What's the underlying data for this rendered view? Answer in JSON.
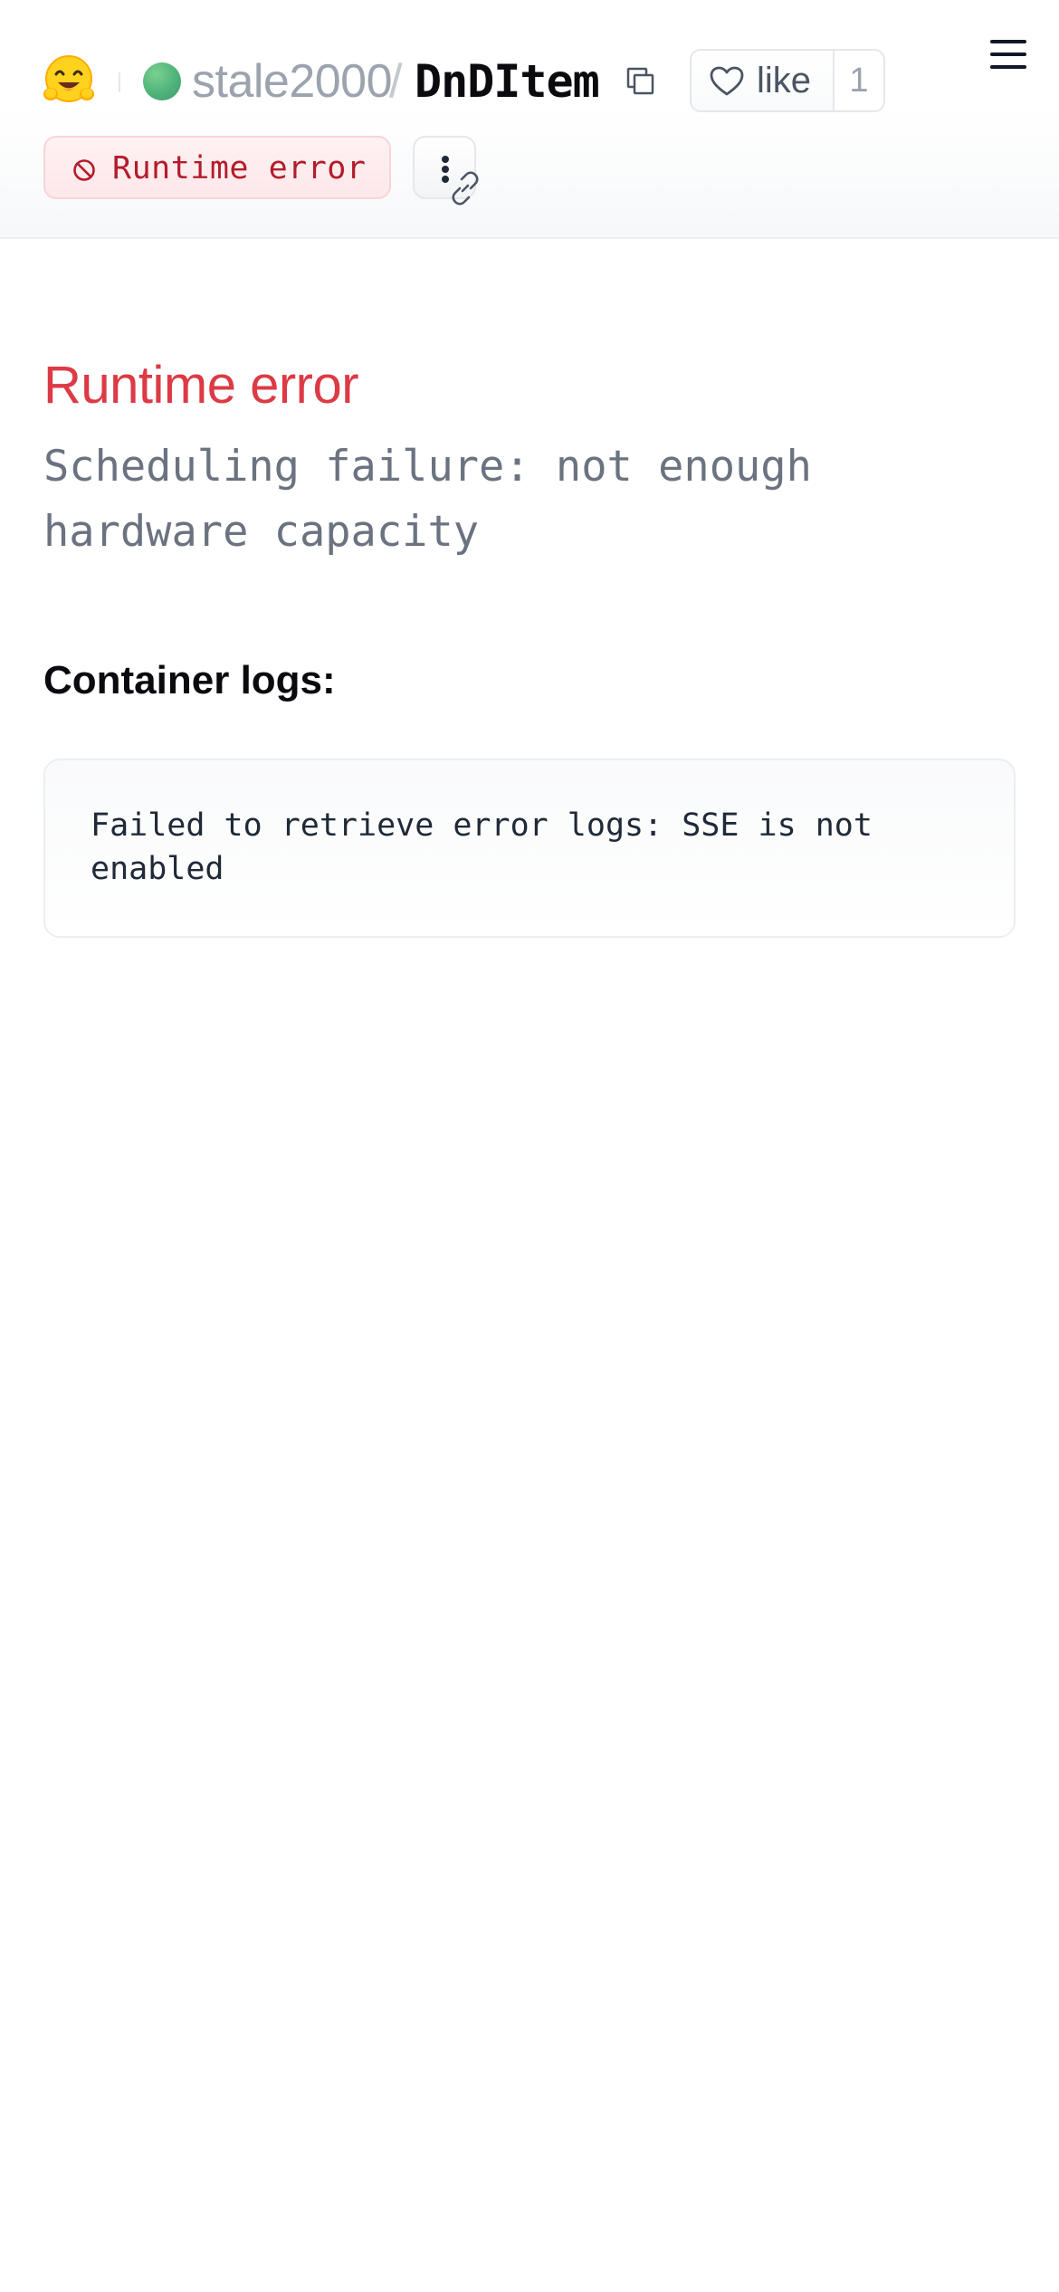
{
  "header": {
    "owner": "stale2000",
    "separator": "/",
    "repo_name": "DnDItem",
    "like_label": "like",
    "like_count": "1",
    "status_label": "Runtime error",
    "status_color": "#dc3a45",
    "icons": {
      "logo": "hugging-face-logo",
      "avatar": "owner-avatar",
      "copy": "copy-icon",
      "like": "heart-icon",
      "menu": "hamburger-menu-icon",
      "status": "ban-icon",
      "more": "more-vertical-icon",
      "link": "link-icon"
    }
  },
  "main": {
    "error_title": "Runtime error",
    "error_message": "Scheduling failure: not enough hardware capacity",
    "logs_heading": "Container logs:",
    "logs_text": "Failed to retrieve error logs: SSE is not enabled"
  },
  "colors": {
    "accent_error": "#dc3a45",
    "badge_background": "#fde8ea",
    "muted_text": "#6b7280",
    "avatar_green": "#4fb37a"
  }
}
